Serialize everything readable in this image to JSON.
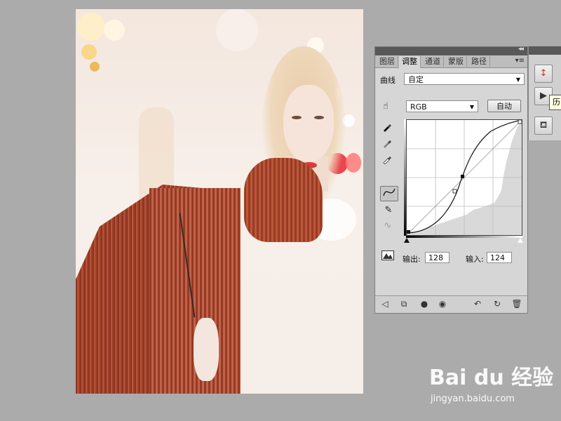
{
  "panel": {
    "tabs": [
      "图层",
      "调整",
      "通道",
      "蒙版",
      "路径"
    ],
    "active_tab": "调整",
    "collapse_glyph": "◂◂",
    "menu_glyph": "▾≡"
  },
  "curves": {
    "title": "曲线",
    "preset_value": "自定",
    "channel_value": "RGB",
    "auto_label": "自动",
    "output_label": "输出:",
    "output_value": "128",
    "input_label": "输入:",
    "input_value": "124"
  },
  "dock": {
    "tooltip": "历"
  },
  "watermark": {
    "brand": "Bai du 经验",
    "url": "jingyan.baidu.com"
  },
  "colors": {
    "panel_bg": "#d6d6d6",
    "app_bg": "#ababab",
    "sweater": "#a8472f"
  },
  "icons": [
    "target-adjust-icon",
    "eyedropper-black-icon",
    "eyedropper-gray-icon",
    "eyedropper-white-icon",
    "curve-tool-icon",
    "pencil-tool-icon",
    "smooth-icon",
    "clip-warning-icon",
    "back-arrow-icon",
    "expand-view-icon",
    "clip-layer-icon",
    "visibility-eye-icon",
    "previous-state-icon",
    "reset-icon",
    "trash-icon"
  ]
}
